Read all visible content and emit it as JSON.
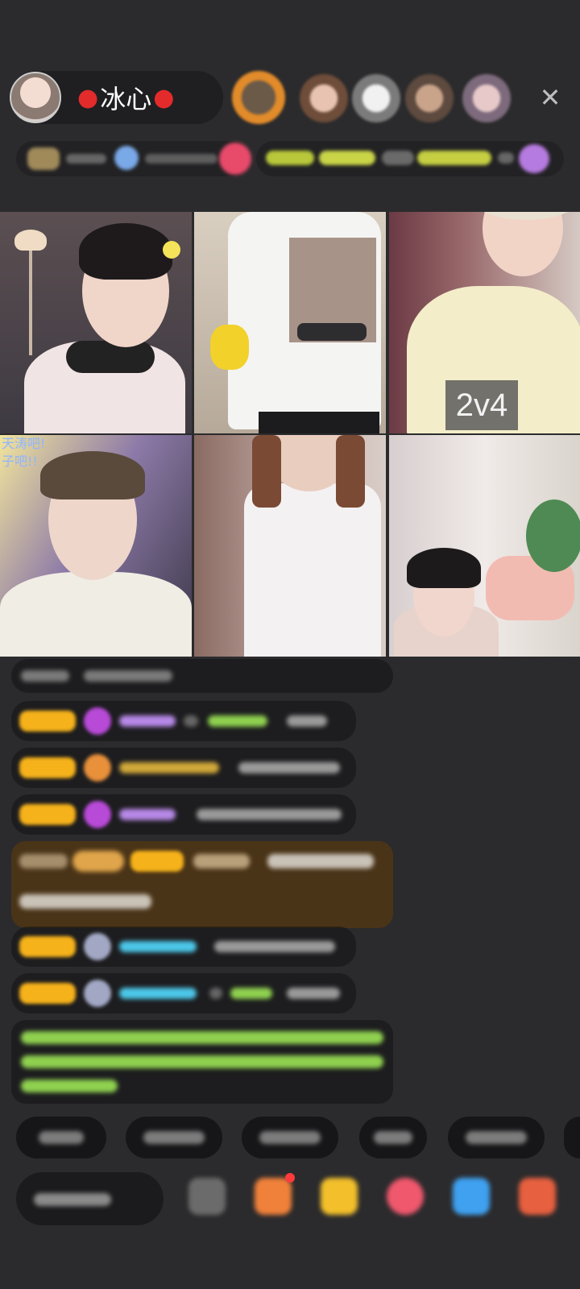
{
  "host": {
    "name": "冰心",
    "decoration_icon": "apple-icon"
  },
  "close_icon": "close-icon",
  "grid": {
    "pk_badge": "2v4",
    "overlay_text_line1": "天涛吧!",
    "overlay_text_line2": "子吧!!"
  },
  "colors": {
    "background": "#2b2b2d",
    "badge_yellow": "#f6b21a",
    "username_purple": "#b889e8",
    "username_cyan": "#4cc7e8",
    "system_green": "#8fd14f",
    "highlight_brown": "#4a3418"
  },
  "bottom_icons": [
    "emoji-icon",
    "gift-box-icon",
    "fries-icon",
    "heart-icon",
    "controller-icon",
    "grid-icon"
  ]
}
